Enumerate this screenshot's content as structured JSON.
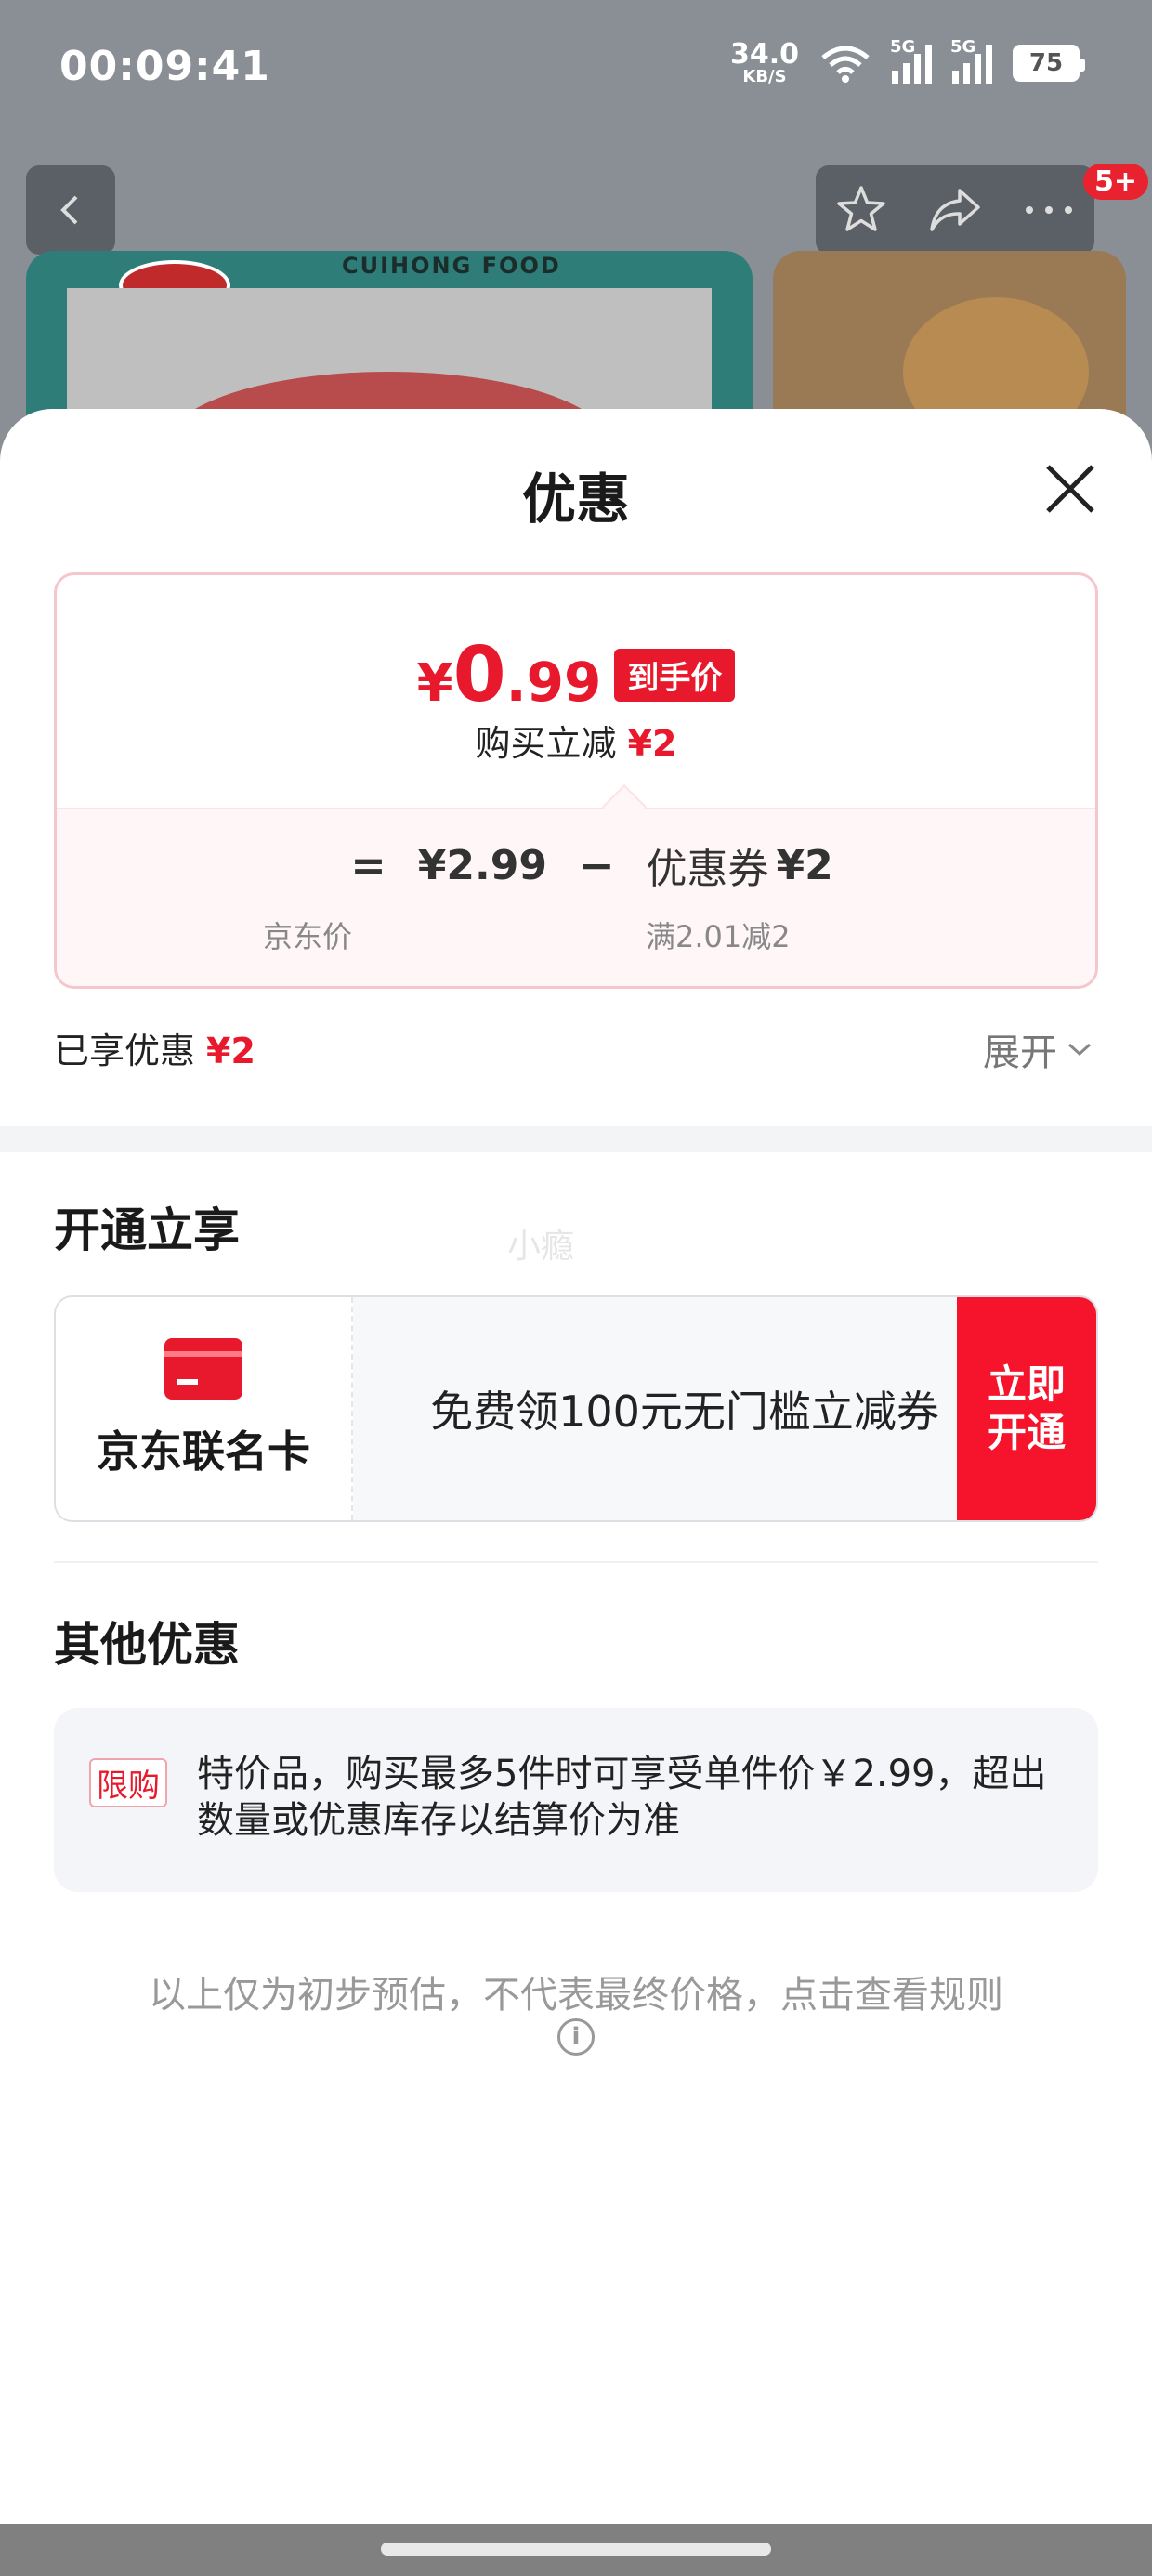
{
  "status_bar": {
    "time": "00:09:41",
    "net_speed": "34.0",
    "net_speed_unit": "KB/S",
    "sim1_label": "5G",
    "sim2_label": "5G",
    "battery": "75"
  },
  "background_page": {
    "badge": "5+",
    "brand_text": "CUIHONG FOOD"
  },
  "sheet": {
    "title": "优惠",
    "price_card": {
      "currency": "¥",
      "final_int": "0",
      "final_dec": ".99",
      "final_tag": "到手价",
      "instant_reduce_label": "购买立减",
      "instant_reduce_value": "¥2",
      "formula_eq": "=",
      "jd_price": "¥2.99",
      "formula_minus": "−",
      "coupon_label": "优惠券",
      "coupon_value": "¥2",
      "jd_price_label": "京东价",
      "coupon_condition": "满2.01减2"
    },
    "enjoyed_label": "已享优惠",
    "enjoyed_value": "¥2",
    "expand_label": "展开"
  },
  "open_section": {
    "title": "开通立享",
    "watermark": "小瘾",
    "card_name": "京东联名卡",
    "card_offer": "免费领100元无门槛立减券",
    "button_line1": "立即",
    "button_line2": "开通"
  },
  "other_section": {
    "title": "其他优惠",
    "tag": "限购",
    "text": "特价品，购买最多5件时可享受单件价￥2.99，超出数量或优惠库存以结算价为准"
  },
  "footer_note": "以上仅为初步预估，不代表最终价格，点击查看规则",
  "colors": {
    "accent_red": "#e8192c",
    "button_red": "#f5142b"
  }
}
